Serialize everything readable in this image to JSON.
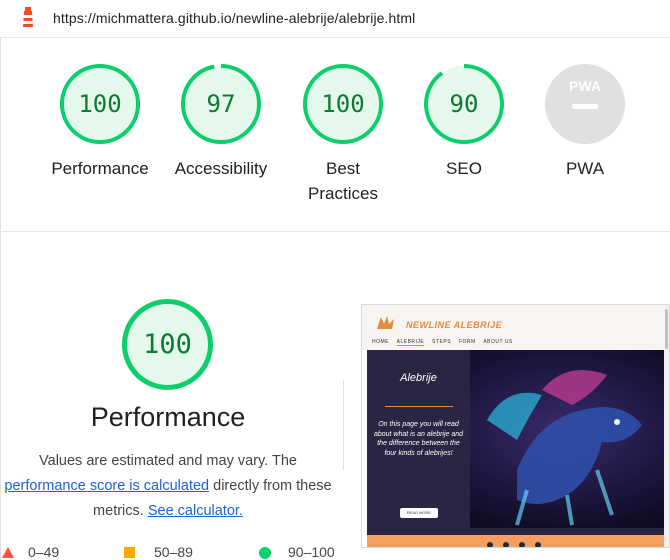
{
  "url": "https://michmattera.github.io/newline-alebrije/alebrije.html",
  "colors": {
    "pass": "#0cce6b",
    "pass_fill": "#e5f8ec",
    "pass_text": "#0a7c2f",
    "average": "#ffa400",
    "fail": "#ff4e42",
    "na": "#e0e0e0"
  },
  "categories": [
    {
      "id": "performance",
      "score": "100",
      "value": 1.0,
      "label": "Performance"
    },
    {
      "id": "accessibility",
      "score": "97",
      "value": 0.97,
      "label": "Accessibility"
    },
    {
      "id": "best-practices",
      "score": "100",
      "value": 1.0,
      "label": "Best Practices"
    },
    {
      "id": "seo",
      "score": "90",
      "value": 0.9,
      "label": "SEO"
    },
    {
      "id": "pwa",
      "score": "",
      "value": null,
      "label": "PWA",
      "icon": "PWA"
    }
  ],
  "performance": {
    "score": "100",
    "title": "Performance",
    "desc_1": "Values are estimated and may vary. The",
    "link_1": "performance score is calculated",
    "desc_2": " directly from these metrics.",
    "link_2": "See calculator."
  },
  "legend": [
    {
      "range": "0–49",
      "shape": "triangle",
      "color": "#ff4e42"
    },
    {
      "range": "50–89",
      "shape": "square",
      "color": "#ffa400"
    },
    {
      "range": "90–100",
      "shape": "circle",
      "color": "#0cce6b"
    }
  ],
  "screenshot": {
    "brand": "NEWLINE ALEBRIJE",
    "nav": [
      "HOME",
      "ALEBRIJE",
      "STEPS",
      "FORM",
      "ABOUT US"
    ],
    "hero_title": "Alebrije",
    "hero_text": "On this page you will read about what is an alebrije and the difference between the four kinds of alebrijes!",
    "button": "READ MORE"
  }
}
